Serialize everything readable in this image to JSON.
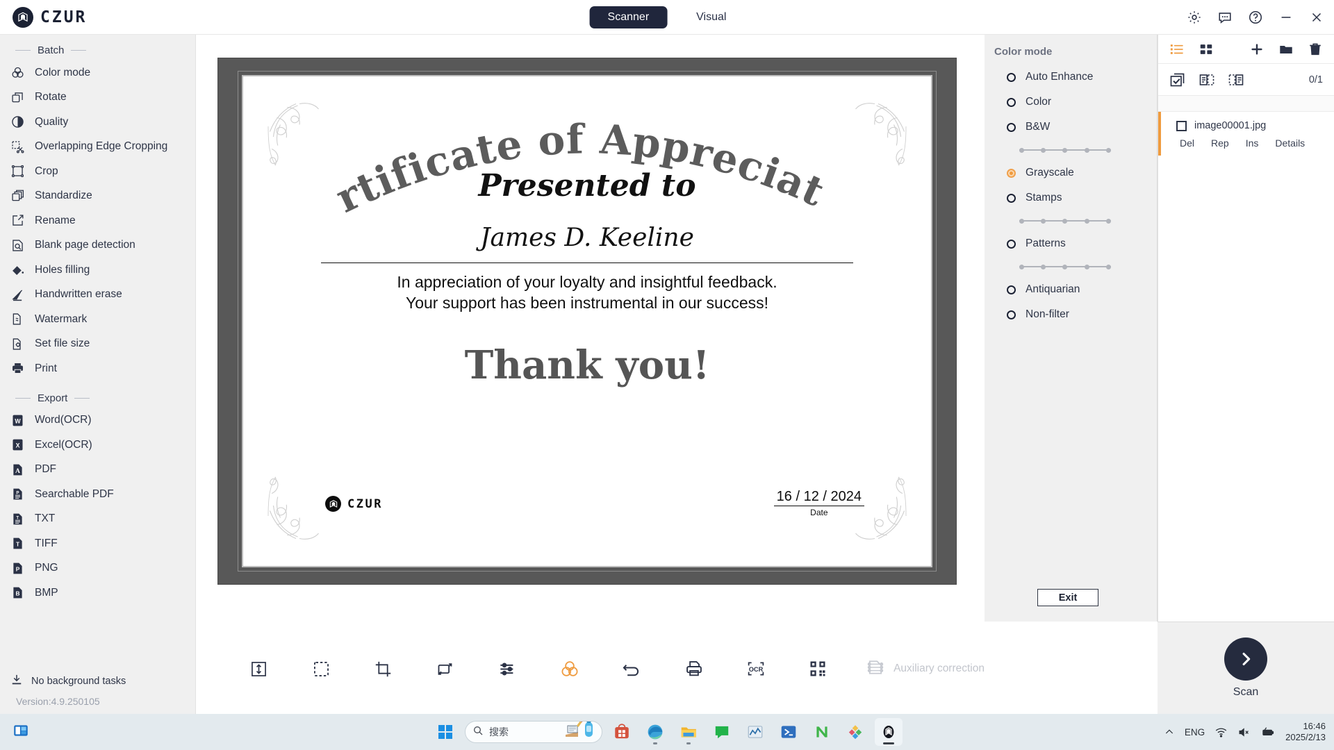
{
  "app": {
    "brand": "CZUR",
    "version": "Version:4.9.250105",
    "background_task": "No background tasks"
  },
  "titlebar": {
    "tabs": [
      {
        "label": "Scanner",
        "active": true
      },
      {
        "label": "Visual",
        "active": false
      }
    ],
    "controls": [
      {
        "name": "settings-icon",
        "glyph": "gear"
      },
      {
        "name": "feedback-icon",
        "glyph": "chat"
      },
      {
        "name": "help-icon",
        "glyph": "question"
      },
      {
        "name": "minimize-icon",
        "glyph": "minus"
      },
      {
        "name": "close-icon",
        "glyph": "close"
      }
    ]
  },
  "sidebar": {
    "sections": [
      {
        "title": "Batch",
        "items": [
          {
            "label": "Color mode",
            "icon": "color-mode-icon"
          },
          {
            "label": "Rotate",
            "icon": "rotate-icon"
          },
          {
            "label": "Quality",
            "icon": "quality-icon"
          },
          {
            "label": "Overlapping Edge Cropping",
            "icon": "overlap-crop-icon"
          },
          {
            "label": "Crop",
            "icon": "crop-icon"
          },
          {
            "label": "Standardize",
            "icon": "standardize-icon"
          },
          {
            "label": "Rename",
            "icon": "rename-icon"
          },
          {
            "label": "Blank page detection",
            "icon": "blank-page-icon"
          },
          {
            "label": "Holes filling",
            "icon": "holes-filling-icon"
          },
          {
            "label": "Handwritten erase",
            "icon": "handwritten-erase-icon"
          },
          {
            "label": "Watermark",
            "icon": "watermark-icon"
          },
          {
            "label": "Set file size",
            "icon": "file-size-icon"
          },
          {
            "label": "Print",
            "icon": "print-icon"
          }
        ]
      },
      {
        "title": "Export",
        "items": [
          {
            "label": "Word(OCR)",
            "icon": "word-icon",
            "badge": "W"
          },
          {
            "label": "Excel(OCR)",
            "icon": "excel-icon",
            "badge": "X"
          },
          {
            "label": "PDF",
            "icon": "pdf-icon",
            "badge": "A"
          },
          {
            "label": "Searchable PDF",
            "icon": "searchable-pdf-icon",
            "badge": "P"
          },
          {
            "label": "TXT",
            "icon": "txt-icon",
            "badge": "T"
          },
          {
            "label": "TIFF",
            "icon": "tiff-icon",
            "badge": "T"
          },
          {
            "label": "PNG",
            "icon": "png-icon",
            "badge": "P"
          },
          {
            "label": "BMP",
            "icon": "bmp-icon",
            "badge": "B"
          }
        ]
      }
    ]
  },
  "certificate": {
    "title": "Certificate of Appreciation",
    "presented_to": "Presented to",
    "recipient": "James D. Keeline",
    "body_line1": "In appreciation of your loyalty and insightful feedback.",
    "body_line2": "Your support has been instrumental in our success!",
    "thanks": "Thank you!",
    "logo_text": "CZUR",
    "date_value": "16 / 12 / 2024",
    "date_label": "Date"
  },
  "bottom_toolbar": {
    "buttons": [
      {
        "name": "fit-height-icon",
        "label": "Fit height"
      },
      {
        "name": "select-area-icon",
        "label": "Select area"
      },
      {
        "name": "crop-icon",
        "label": "Crop"
      },
      {
        "name": "rotate-icon",
        "label": "Rotate"
      },
      {
        "name": "adjust-icon",
        "label": "Adjust"
      },
      {
        "name": "color-mode-icon",
        "label": "Color mode",
        "accent": true
      },
      {
        "name": "undo-icon",
        "label": "Undo"
      },
      {
        "name": "print-icon",
        "label": "Print"
      },
      {
        "name": "ocr-icon",
        "label": "OCR"
      },
      {
        "name": "qrcode-icon",
        "label": "QR code"
      }
    ],
    "auxiliary_label": "Auxiliary correction"
  },
  "color_panel": {
    "title": "Color mode",
    "options": [
      {
        "label": "Auto Enhance",
        "selected": false,
        "slider": false
      },
      {
        "label": "Color",
        "selected": false,
        "slider": false
      },
      {
        "label": "B&W",
        "selected": false,
        "slider": true
      },
      {
        "label": "Grayscale",
        "selected": true,
        "slider": false
      },
      {
        "label": "Stamps",
        "selected": false,
        "slider": true
      },
      {
        "label": "Patterns",
        "selected": false,
        "slider": true
      },
      {
        "label": "Antiquarian",
        "selected": false,
        "slider": false
      },
      {
        "label": "Non-filter",
        "selected": false,
        "slider": false
      }
    ],
    "exit_label": "Exit",
    "accent_color": "#ef9b3f"
  },
  "file_panel": {
    "toolbar_icons": [
      {
        "name": "list-view-icon",
        "accent": true
      },
      {
        "name": "grid-view-icon",
        "accent": false
      },
      {
        "name": "add-icon",
        "accent": false
      },
      {
        "name": "folder-icon",
        "accent": false
      },
      {
        "name": "delete-icon",
        "accent": false
      }
    ],
    "select_icons": [
      {
        "name": "select-all-icon"
      },
      {
        "name": "select-odd-icon"
      },
      {
        "name": "select-even-icon"
      }
    ],
    "count": "0/1",
    "files": [
      {
        "name": "image00001.jpg",
        "checked": false,
        "actions": [
          "Del",
          "Rep",
          "Ins",
          "Details"
        ]
      }
    ]
  },
  "scan": {
    "label": "Scan"
  },
  "taskbar": {
    "search_placeholder": "搜索",
    "apps": [
      {
        "name": "store-icon"
      },
      {
        "name": "edge-icon"
      },
      {
        "name": "file-explorer-icon"
      },
      {
        "name": "chat-icon"
      },
      {
        "name": "charts-icon"
      },
      {
        "name": "powershell-icon"
      },
      {
        "name": "nvidia-icon"
      },
      {
        "name": "photos-icon"
      },
      {
        "name": "czur-app-icon"
      }
    ],
    "tray": {
      "language": "ENG",
      "time": "16:46",
      "date": "2025/2/13"
    }
  }
}
